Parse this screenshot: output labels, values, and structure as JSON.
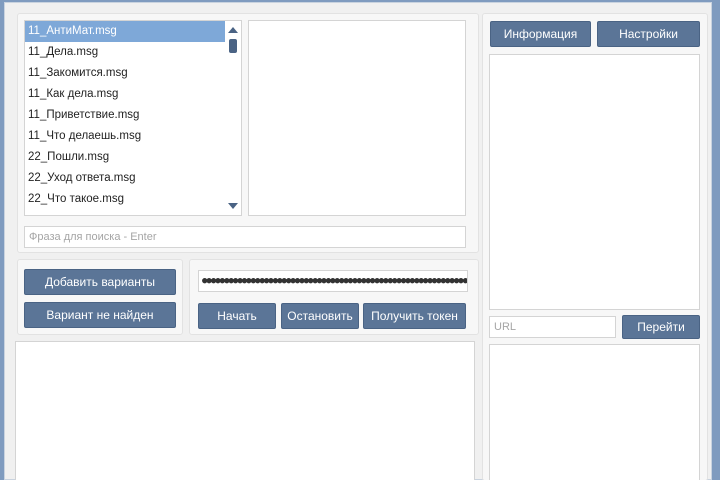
{
  "file_list": {
    "items": [
      {
        "label": "11_АнтиМат.msg",
        "selected": true
      },
      {
        "label": "11_Дела.msg",
        "selected": false
      },
      {
        "label": "11_Закомится.msg",
        "selected": false
      },
      {
        "label": "11_Как дела.msg",
        "selected": false
      },
      {
        "label": "11_Приветствие.msg",
        "selected": false
      },
      {
        "label": "11_Что делаешь.msg",
        "selected": false
      },
      {
        "label": "22_Пошли.msg",
        "selected": false
      },
      {
        "label": "22_Уход ответа.msg",
        "selected": false
      },
      {
        "label": "22_Что такое.msg",
        "selected": false
      }
    ]
  },
  "search": {
    "placeholder": "Фраза для поиска - Enter",
    "value": ""
  },
  "variants": {
    "add_label": "Добавить варианты",
    "not_found_label": "Вариант не найден"
  },
  "token": {
    "masked_value": "●●●●●●●●●●●●●●●●●●●●●●●●●●●●●●●●●●●●●●●●●●●●●●●●●●●●●●●●●●●●●●●●●●●●●●●●●●●●●",
    "start_label": "Начать",
    "stop_label": "Остановить",
    "get_token_label": "Получить токен"
  },
  "right_panel": {
    "info_label": "Информация",
    "settings_label": "Настройки",
    "url_placeholder": "URL",
    "go_label": "Перейти"
  },
  "colors": {
    "button": "#5b7597",
    "selection": "#7ea8d8",
    "background": "#f0f0f0"
  }
}
